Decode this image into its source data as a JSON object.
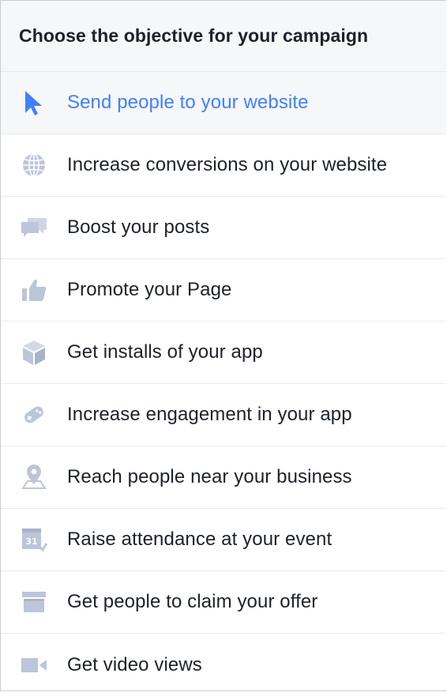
{
  "header": {
    "title": "Choose the objective for your campaign"
  },
  "colors": {
    "selected_text": "#4080ff",
    "icon_gray": "#bcc5d9",
    "text": "#1d2129",
    "header_bg": "#f6f7f9"
  },
  "objectives": [
    {
      "label": "Send people to your website",
      "icon": "cursor-icon",
      "selected": true
    },
    {
      "label": "Increase conversions on your website",
      "icon": "globe-icon",
      "selected": false
    },
    {
      "label": "Boost your posts",
      "icon": "chat-bubbles-icon",
      "selected": false
    },
    {
      "label": "Promote your Page",
      "icon": "thumbs-up-icon",
      "selected": false
    },
    {
      "label": "Get installs of your app",
      "icon": "app-box-icon",
      "selected": false
    },
    {
      "label": "Increase engagement in your app",
      "icon": "gamepad-icon",
      "selected": false
    },
    {
      "label": "Reach people near your business",
      "icon": "map-pin-icon",
      "selected": false
    },
    {
      "label": "Raise attendance at your event",
      "icon": "calendar-icon",
      "selected": false
    },
    {
      "label": "Get people to claim your offer",
      "icon": "storefront-icon",
      "selected": false
    },
    {
      "label": "Get video views",
      "icon": "video-camera-icon",
      "selected": false
    }
  ]
}
